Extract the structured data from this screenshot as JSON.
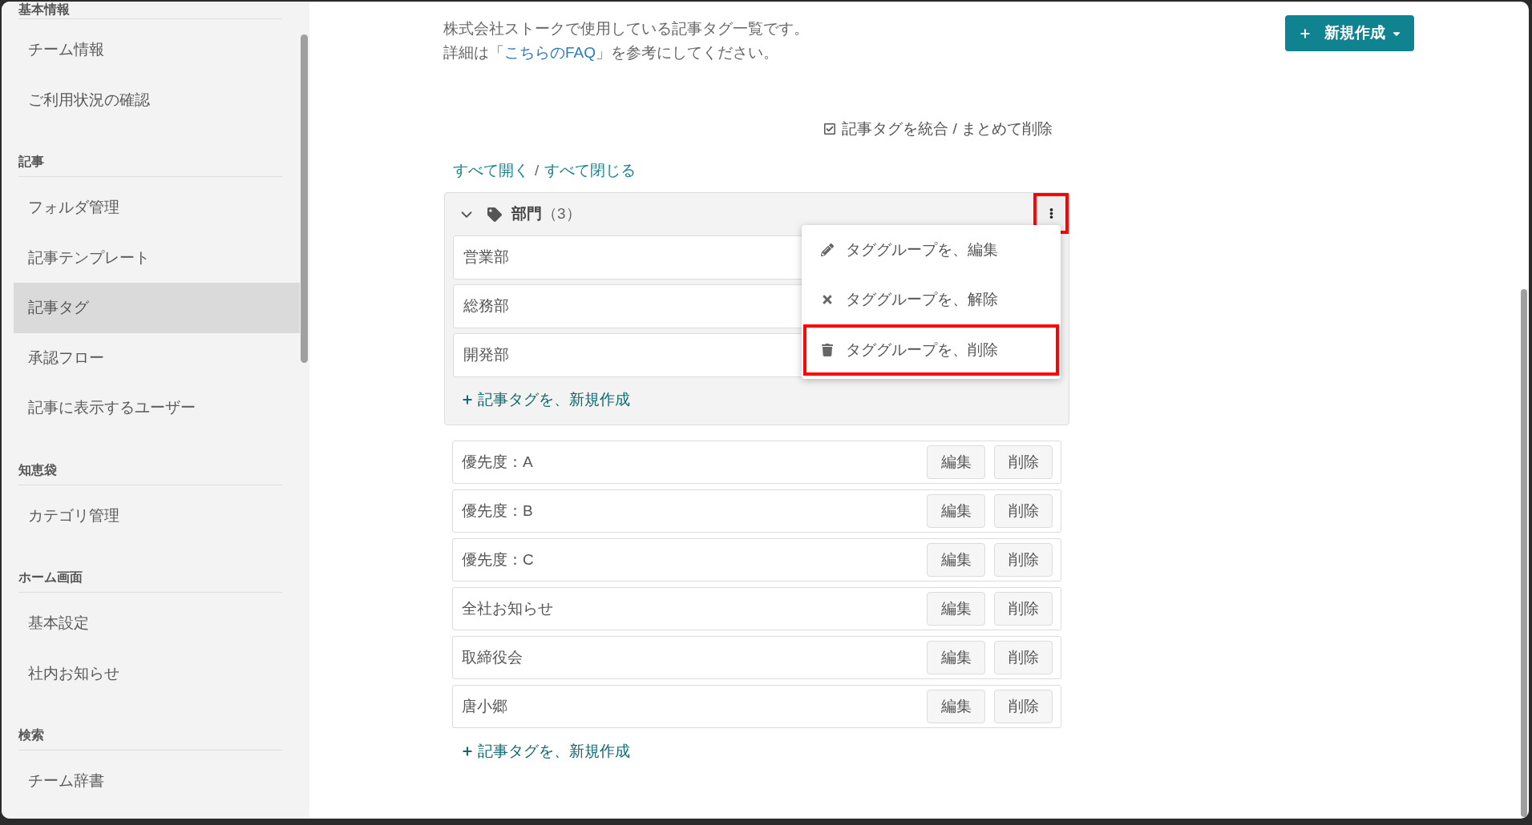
{
  "sidebar": {
    "sections": [
      {
        "title": "基本情報",
        "items": [
          {
            "label": "チーム情報",
            "selected": false
          },
          {
            "label": "ご利用状況の確認",
            "selected": false
          }
        ]
      },
      {
        "title": "記事",
        "items": [
          {
            "label": "フォルダ管理",
            "selected": false
          },
          {
            "label": "記事テンプレート",
            "selected": false
          },
          {
            "label": "記事タグ",
            "selected": true
          },
          {
            "label": "承認フロー",
            "selected": false
          },
          {
            "label": "記事に表示するユーザー",
            "selected": false
          }
        ]
      },
      {
        "title": "知恵袋",
        "items": [
          {
            "label": "カテゴリ管理",
            "selected": false
          }
        ]
      },
      {
        "title": "ホーム画面",
        "items": [
          {
            "label": "基本設定",
            "selected": false
          },
          {
            "label": "社内お知らせ",
            "selected": false
          }
        ]
      },
      {
        "title": "検索",
        "items": [
          {
            "label": "チーム辞書",
            "selected": false
          }
        ]
      }
    ]
  },
  "description": {
    "line_1": "株式会社ストークで使用している記事タグ一覧です。",
    "line_2_before": "詳細は「",
    "faq_link": "こちらのFAQ",
    "line_2_after": "」を参考にしてください。"
  },
  "new_button": {
    "label": "新規作成"
  },
  "merge_link": {
    "label": "記事タグを統合 / まとめて削除"
  },
  "expand_controls": {
    "expand_all": "すべて開く",
    "separator": "/",
    "collapse_all": "すべて閉じる"
  },
  "tag_group": {
    "name": "部門",
    "count": "（3）",
    "expanded": true,
    "menu_button": {
      "highlighted": true
    },
    "tags": [
      {
        "name": "営業部"
      },
      {
        "name": "総務部"
      },
      {
        "name": "開発部"
      }
    ],
    "add_link": "記事タグを、新規作成",
    "menu": {
      "open": true,
      "items": [
        {
          "kind": "edit",
          "label": "タググループを、編集",
          "highlighted": false
        },
        {
          "kind": "remove",
          "label": "タググループを、解除",
          "highlighted": false
        },
        {
          "kind": "delete",
          "label": "タググループを、削除",
          "highlighted": true
        }
      ]
    }
  },
  "tags": [
    {
      "name": "優先度：A",
      "buttons": [
        "編集",
        "削除"
      ]
    },
    {
      "name": "優先度：B",
      "buttons": [
        "編集",
        "削除"
      ]
    },
    {
      "name": "優先度：C",
      "buttons": [
        "編集",
        "削除"
      ]
    },
    {
      "name": "全社お知らせ",
      "buttons": [
        "編集",
        "削除"
      ]
    },
    {
      "name": "取締役会",
      "buttons": [
        "編集",
        "削除"
      ]
    },
    {
      "name": "唐小郷",
      "buttons": [
        "編集",
        "削除"
      ]
    }
  ],
  "add_tag_link": "記事タグを、新規作成"
}
